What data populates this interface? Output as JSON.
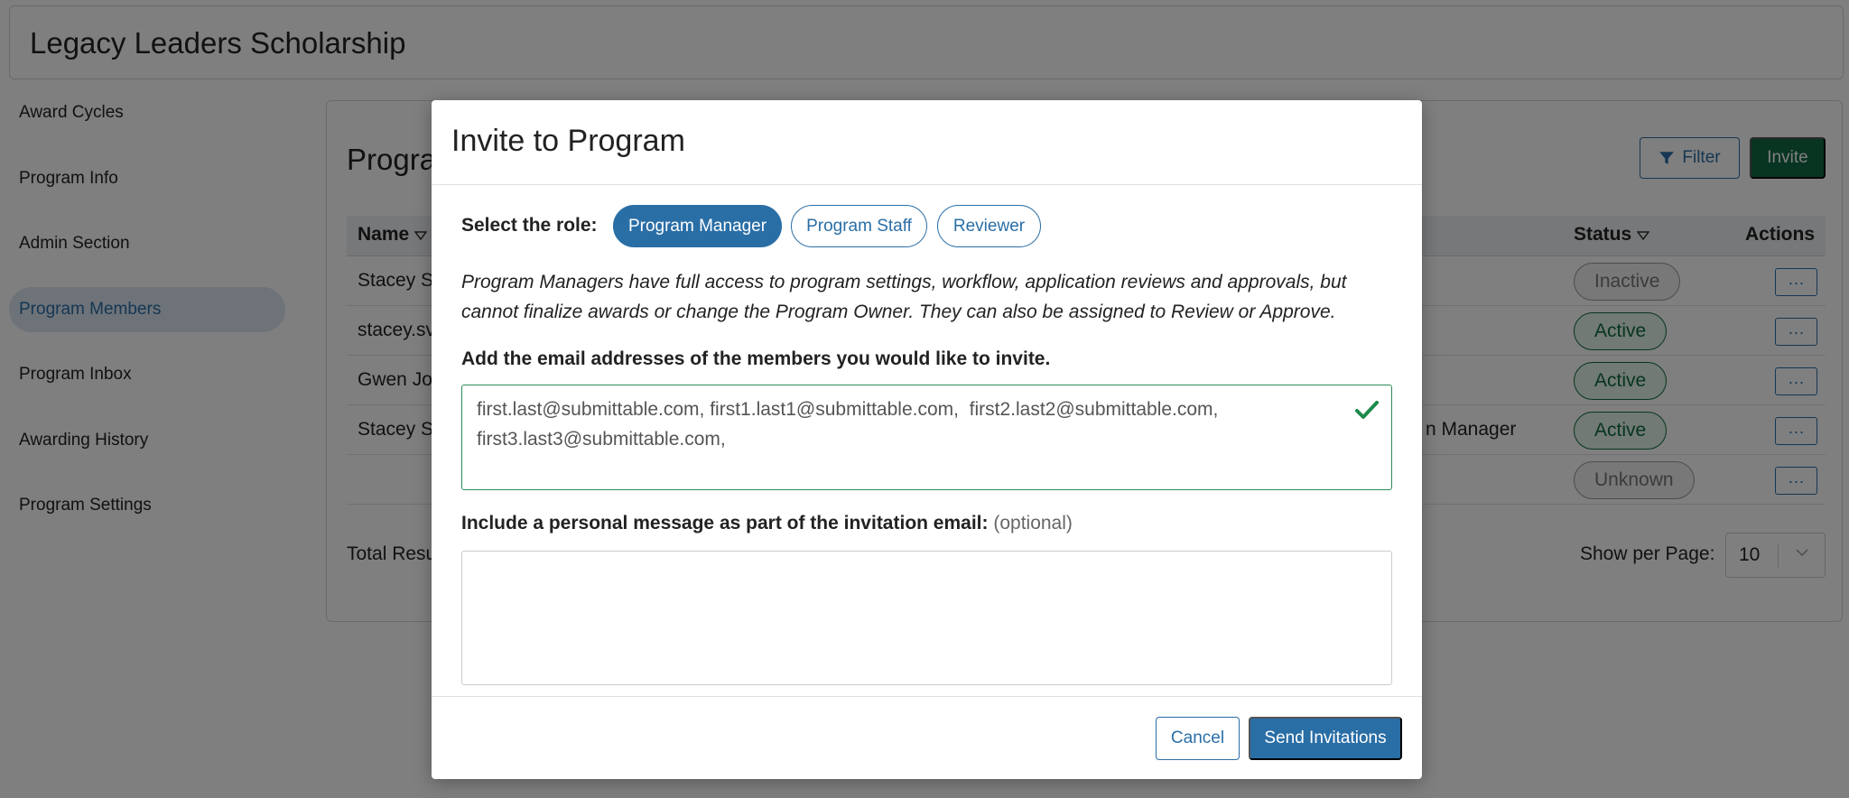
{
  "app": {
    "title": "Legacy Leaders Scholarship"
  },
  "sidebar": {
    "items": [
      {
        "label": "Award Cycles"
      },
      {
        "label": "Program Info"
      },
      {
        "label": "Admin Section"
      },
      {
        "label": "Program Members",
        "active": true
      },
      {
        "label": "Program Inbox"
      },
      {
        "label": "Awarding History"
      },
      {
        "label": "Program Settings"
      }
    ]
  },
  "panel": {
    "title": "Progra",
    "filter_label": "Filter",
    "invite_label": "Invite",
    "columns": {
      "name": "Name",
      "status": "Status",
      "actions": "Actions"
    },
    "rows": [
      {
        "name": "Stacey Sv",
        "role": "",
        "status": "Inactive"
      },
      {
        "name": "stacey.sv",
        "role": "",
        "status": "Active"
      },
      {
        "name": "Gwen Jo",
        "role": "",
        "status": "Active"
      },
      {
        "name": "Stacey Sv",
        "role": "n Manager",
        "status": "Active"
      },
      {
        "name": "",
        "role": "",
        "status": "Unknown"
      }
    ],
    "actions_glyph": "···",
    "total_label": "Total Resu",
    "per_page_label": "Show per Page:",
    "per_page_value": "10"
  },
  "modal": {
    "title": "Invite to Program",
    "role_label": "Select the role:",
    "roles": [
      {
        "label": "Program Manager",
        "selected": true
      },
      {
        "label": "Program Staff",
        "selected": false
      },
      {
        "label": "Reviewer",
        "selected": false
      }
    ],
    "role_description": "Program Managers have full access to program settings, workflow, application reviews and approvals, but cannot finalize awards or change the Program Owner. They can also be assigned to Review or Approve.",
    "email_label": "Add the email addresses of the members you would like to invite.",
    "email_value": "first.last@submittable.com, first1.last1@submittable.com,  first2.last2@submittable.com, first3.last3@submittable.com,",
    "message_label": "Include a personal message as part of the invitation email:",
    "message_optional": "(optional)",
    "message_value": "",
    "cancel_label": "Cancel",
    "send_label": "Send Invitations"
  },
  "colors": {
    "primary": "#2a6ea6",
    "invite_green": "#116b45",
    "active_green": "#0f6b3c",
    "valid_check": "#1e8a4c"
  }
}
